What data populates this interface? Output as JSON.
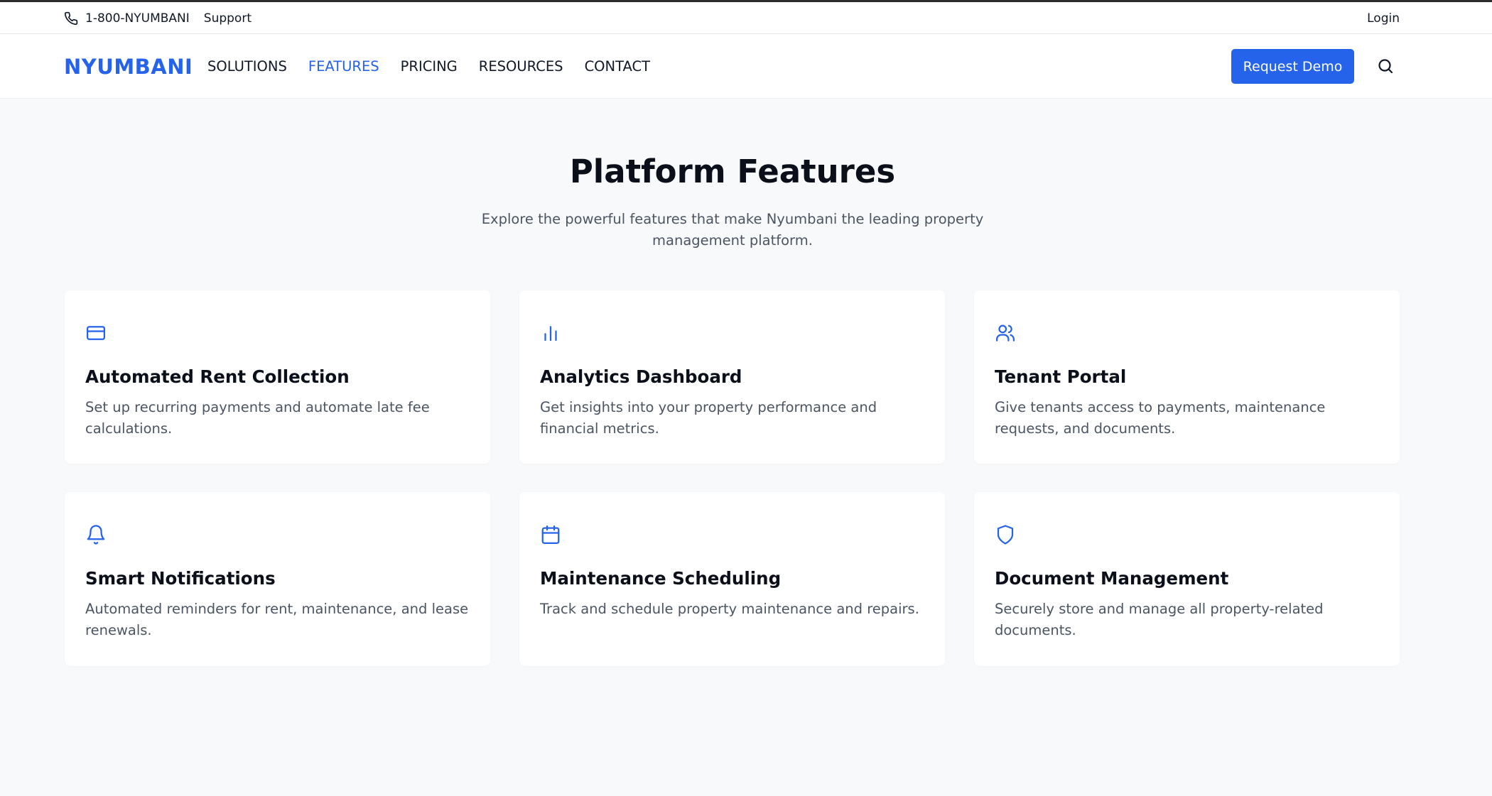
{
  "topbar": {
    "phone": "1-800-NYUMBANI",
    "support": "Support",
    "login": "Login"
  },
  "nav": {
    "logo": "NYUMBANI",
    "links": [
      {
        "label": "SOLUTIONS",
        "active": false
      },
      {
        "label": "FEATURES",
        "active": true
      },
      {
        "label": "PRICING",
        "active": false
      },
      {
        "label": "RESOURCES",
        "active": false
      },
      {
        "label": "CONTACT",
        "active": false
      }
    ],
    "cta": "Request Demo",
    "search_icon": "search-icon"
  },
  "hero": {
    "title": "Platform Features",
    "subtitle": "Explore the powerful features that make Nyumbani the leading property management platform."
  },
  "features": [
    {
      "icon": "credit-card-icon",
      "title": "Automated Rent Collection",
      "description": "Set up recurring payments and automate late fee calculations."
    },
    {
      "icon": "bar-chart-icon",
      "title": "Analytics Dashboard",
      "description": "Get insights into your property performance and financial metrics."
    },
    {
      "icon": "users-icon",
      "title": "Tenant Portal",
      "description": "Give tenants access to payments, maintenance requests, and documents."
    },
    {
      "icon": "bell-icon",
      "title": "Smart Notifications",
      "description": "Automated reminders for rent, maintenance, and lease renewals."
    },
    {
      "icon": "calendar-icon",
      "title": "Maintenance Scheduling",
      "description": "Track and schedule property maintenance and repairs."
    },
    {
      "icon": "shield-icon",
      "title": "Document Management",
      "description": "Securely store and manage all property-related documents."
    }
  ],
  "colors": {
    "accent": "#2563eb",
    "text": "#111827",
    "muted": "#4b5563",
    "background": "#f8f9fb"
  }
}
